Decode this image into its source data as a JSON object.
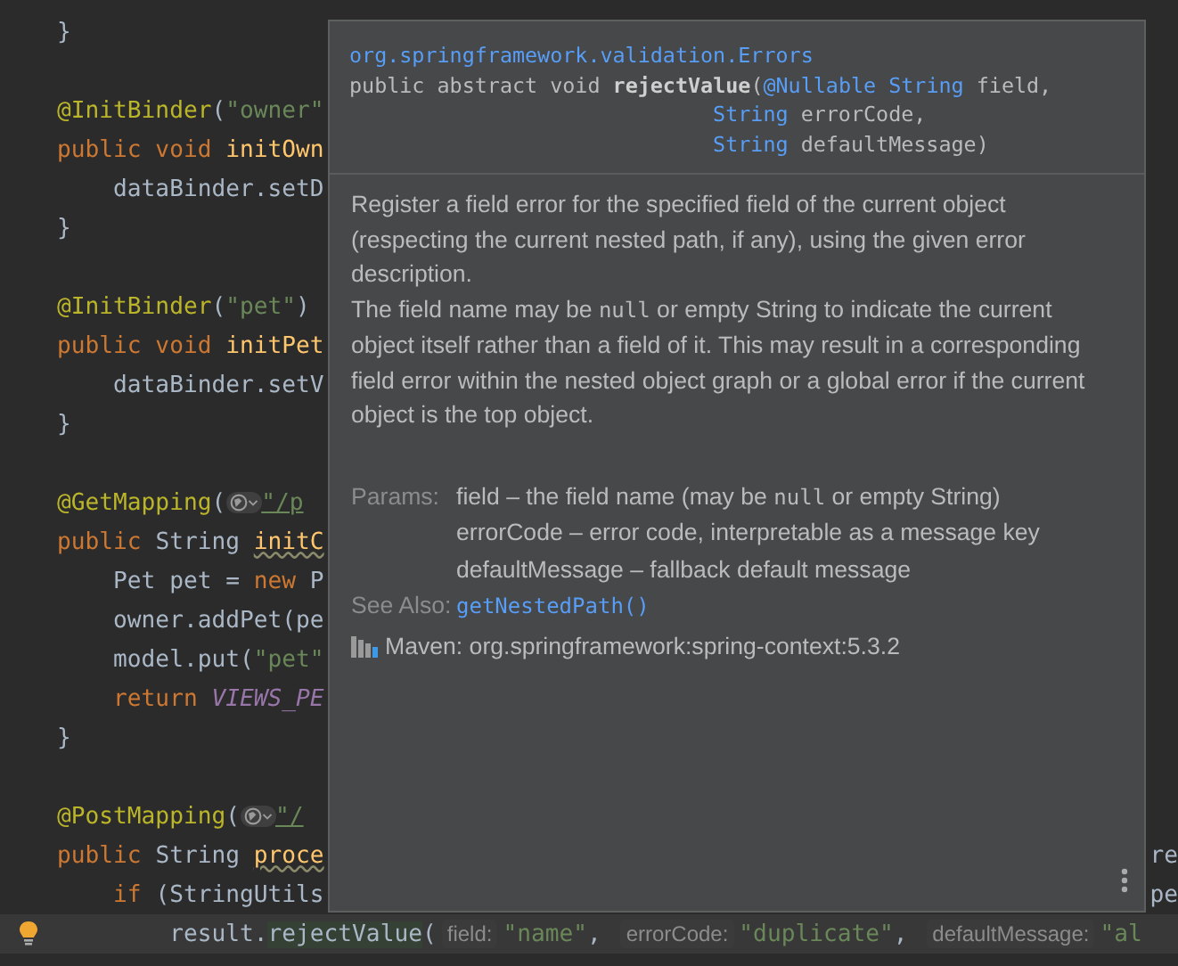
{
  "editor": {
    "blocks": [
      {
        "lines": [
          {
            "tokens": [
              {
                "kind": "plain",
                "text": "}"
              }
            ]
          }
        ]
      },
      {
        "lines": [
          {
            "tokens": [
              {
                "kind": "annotation",
                "text": "@InitBinder"
              },
              {
                "kind": "plain",
                "text": "("
              },
              {
                "kind": "string",
                "text": "\"owner\""
              }
            ]
          },
          {
            "tokens": [
              {
                "kind": "keyword",
                "text": "public void "
              },
              {
                "kind": "decl",
                "text": "initOwn"
              }
            ]
          },
          {
            "tokens": [
              {
                "kind": "plain",
                "text": "    dataBinder.setD"
              }
            ]
          },
          {
            "tokens": [
              {
                "kind": "plain",
                "text": "}"
              }
            ]
          }
        ]
      },
      {
        "lines": [
          {
            "tokens": [
              {
                "kind": "annotation",
                "text": "@InitBinder"
              },
              {
                "kind": "plain",
                "text": "("
              },
              {
                "kind": "string",
                "text": "\"pet\""
              },
              {
                "kind": "plain",
                "text": ")"
              }
            ]
          },
          {
            "tokens": [
              {
                "kind": "keyword",
                "text": "public void "
              },
              {
                "kind": "decl",
                "text": "initPet"
              }
            ]
          },
          {
            "tokens": [
              {
                "kind": "plain",
                "text": "    dataBinder.setV"
              }
            ]
          },
          {
            "tokens": [
              {
                "kind": "plain",
                "text": "}"
              }
            ]
          }
        ]
      },
      {
        "lines": [
          {
            "tokens": [
              {
                "kind": "annotation",
                "text": "@GetMapping"
              },
              {
                "kind": "plain",
                "text": "("
              },
              {
                "kind": "globe"
              },
              {
                "kind": "string-link",
                "text": "\"/p"
              }
            ]
          },
          {
            "tokens": [
              {
                "kind": "keyword",
                "text": "public "
              },
              {
                "kind": "plain",
                "text": "String "
              },
              {
                "kind": "decl-warn",
                "text": "initC"
              }
            ]
          },
          {
            "tokens": [
              {
                "kind": "plain",
                "text": "    Pet pet = "
              },
              {
                "kind": "keyword",
                "text": "new "
              },
              {
                "kind": "plain",
                "text": "P"
              }
            ]
          },
          {
            "tokens": [
              {
                "kind": "plain",
                "text": "    owner.addPet(pe"
              }
            ]
          },
          {
            "tokens": [
              {
                "kind": "plain",
                "text": "    model.put("
              },
              {
                "kind": "string",
                "text": "\"pet\""
              }
            ]
          },
          {
            "tokens": [
              {
                "kind": "keyword",
                "text": "    return "
              },
              {
                "kind": "constant",
                "text": "VIEWS_PE"
              }
            ]
          },
          {
            "tokens": [
              {
                "kind": "plain",
                "text": "}"
              }
            ]
          }
        ]
      },
      {
        "lines": [
          {
            "tokens": [
              {
                "kind": "annotation",
                "text": "@PostMapping"
              },
              {
                "kind": "plain",
                "text": "("
              },
              {
                "kind": "globe"
              },
              {
                "kind": "string-link",
                "text": "\"/"
              }
            ]
          },
          {
            "tokens": [
              {
                "kind": "keyword",
                "text": "public "
              },
              {
                "kind": "plain",
                "text": "String "
              },
              {
                "kind": "decl-warn",
                "text": "proce"
              }
            ],
            "right": [
              {
                "kind": "plain",
                "text": "re"
              }
            ]
          },
          {
            "tokens": [
              {
                "kind": "keyword",
                "text": "    if "
              },
              {
                "kind": "plain",
                "text": "(StringUtils"
              }
            ],
            "right": [
              {
                "kind": "plain",
                "text": "pe"
              }
            ]
          },
          {
            "current": true,
            "bulb": true,
            "tokens": [
              {
                "kind": "plain",
                "text": "        result."
              },
              {
                "kind": "match",
                "text": "rejectValue"
              },
              {
                "kind": "plain",
                "text": "("
              },
              {
                "kind": "hint",
                "text": "field:"
              },
              {
                "kind": "string",
                "text": "\"name\""
              },
              {
                "kind": "plain",
                "text": ", "
              },
              {
                "kind": "hint",
                "text": "errorCode:"
              },
              {
                "kind": "string",
                "text": "\"duplicate\""
              },
              {
                "kind": "plain",
                "text": ", "
              },
              {
                "kind": "hint",
                "text": "defaultMessage:"
              },
              {
                "kind": "string",
                "text": "\"al"
              }
            ]
          }
        ]
      }
    ]
  },
  "popup": {
    "class_name": "org.springframework.validation.Errors",
    "signature": [
      {
        "continued": false,
        "tokens": [
          {
            "kind": "plain",
            "text": "public abstract void "
          },
          {
            "kind": "bold",
            "text": "rejectValue"
          },
          {
            "kind": "plain",
            "text": "("
          },
          {
            "kind": "type",
            "text": "@Nullable String"
          },
          {
            "kind": "plain",
            "text": " field,"
          }
        ]
      },
      {
        "continued": true,
        "tokens": [
          {
            "kind": "type",
            "text": "String"
          },
          {
            "kind": "plain",
            "text": " errorCode,"
          }
        ]
      },
      {
        "continued": true,
        "tokens": [
          {
            "kind": "type",
            "text": "String"
          },
          {
            "kind": "plain",
            "text": " defaultMessage)"
          }
        ]
      }
    ],
    "description": [
      [
        {
          "kind": "text",
          "text": "Register a field error for the specified field of the current object (respecting the current nested path, if any), using the given error description."
        }
      ],
      [
        {
          "kind": "text",
          "text": "The field name may be "
        },
        {
          "kind": "code",
          "text": "null"
        },
        {
          "kind": "text",
          "text": " or empty String to indicate the current object itself rather than a field of it. This may result in a corresponding field error within the nested object graph or a global error if the current object is the top object."
        }
      ]
    ],
    "params_label": "Params:",
    "params": [
      [
        {
          "kind": "text",
          "text": "field – the field name (may be "
        },
        {
          "kind": "code",
          "text": "null"
        },
        {
          "kind": "text",
          "text": " or empty String)"
        }
      ],
      [
        {
          "kind": "text",
          "text": "errorCode – error code, interpretable as a message key"
        }
      ],
      [
        {
          "kind": "text",
          "text": "defaultMessage – fallback default message"
        }
      ]
    ],
    "see_also_label": "See Also:",
    "see_also_link": "getNestedPath()",
    "library": "Maven: org.springframework:spring-context:5.3.2"
  }
}
